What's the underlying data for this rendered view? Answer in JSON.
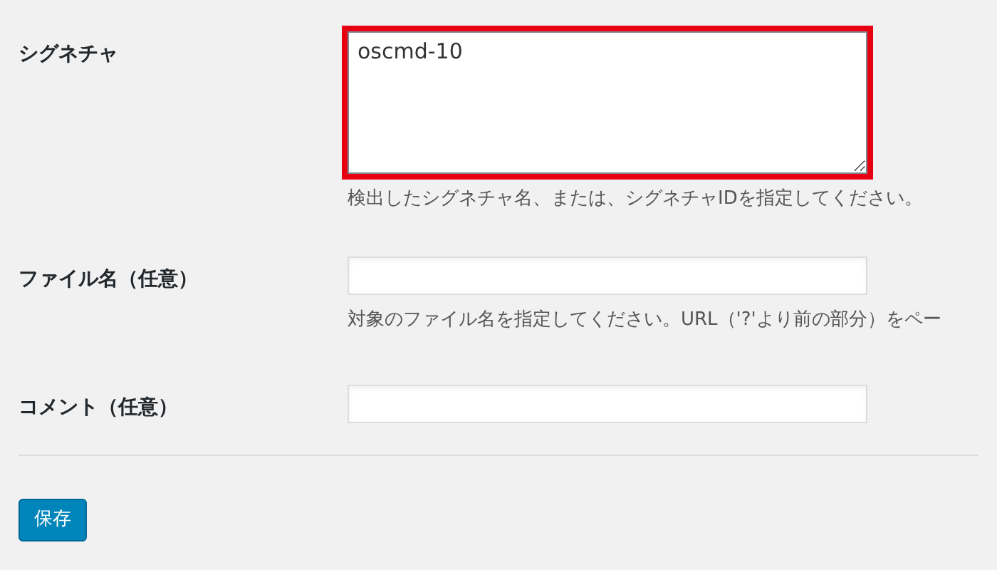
{
  "fields": [
    {
      "kind": "textarea",
      "label": "シグネチャ",
      "value": "oscmd-10",
      "highlighted": true,
      "description": "検出したシグネチャ名、または、シグネチャIDを指定してください。"
    },
    {
      "kind": "text",
      "label": "ファイル名（任意）",
      "highlighted": false,
      "description": "対象のファイル名を指定してください。URL（'?'より前の部分）をペー"
    },
    {
      "kind": "text",
      "label": "コメント（任意）",
      "highlighted": false
    }
  ],
  "save_button": "保存"
}
